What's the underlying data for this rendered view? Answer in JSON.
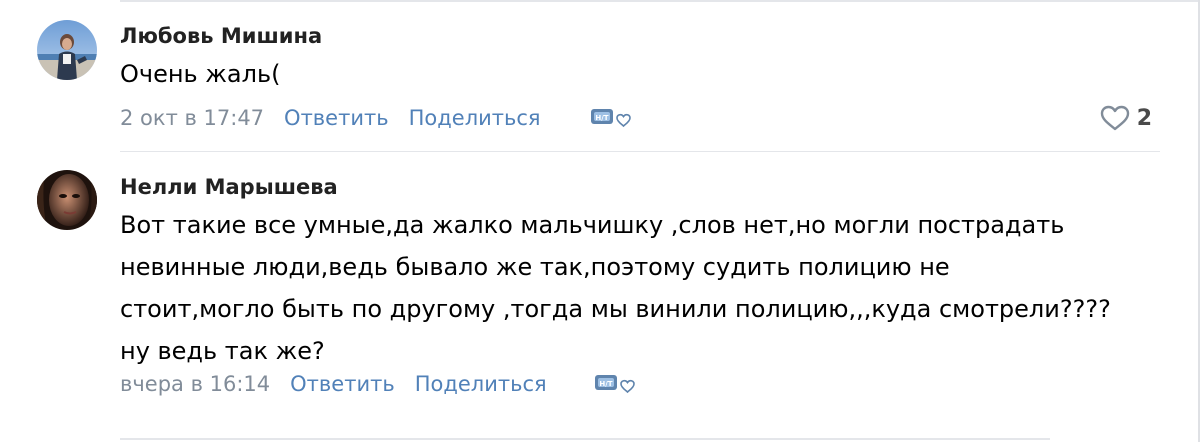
{
  "comments": [
    {
      "author": "Любовь Мишина",
      "text_lines": [
        "Очень жаль("
      ],
      "time": "2 окт в 17:47",
      "reply_label": "Ответить",
      "share_label": "Поделиться",
      "likes": "2"
    },
    {
      "author": "Нелли Марышева",
      "text_lines": [
        "Вот такие все умные,да жалко мальчишку ,слов нет,но могли пострадать",
        "невинные люди,ведь бывало же так,поэтому судить полицию не",
        "стоит,могло быть по другому ,тогда мы винили полицию,,,куда смотрели????",
        "ну ведь так же?"
      ],
      "time": "вчера в 16:14",
      "reply_label": "Ответить",
      "share_label": "Поделиться"
    }
  ],
  "colors": {
    "link": "#5181b8",
    "secondary": "#818c99",
    "divider": "#e4e6ea"
  },
  "icons": {
    "reaction": "sticker-heart-icon",
    "like": "heart-outline-icon"
  }
}
